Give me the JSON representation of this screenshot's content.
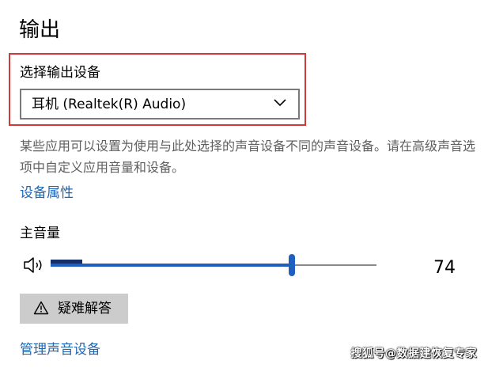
{
  "section": {
    "title": "输出"
  },
  "output_device": {
    "label": "选择输出设备",
    "selected": "耳机 (Realtek(R) Audio)"
  },
  "description": "某些应用可以设置为使用与此处选择的声音设备不同的声音设备。请在高级声音选项中自定义应用音量和设备。",
  "device_properties_link": "设备属性",
  "master_volume": {
    "label": "主音量",
    "value": 74,
    "value_text": "74",
    "level_fraction": 0.74
  },
  "troubleshoot_button": {
    "label": "疑难解答",
    "icon": "warning-icon"
  },
  "manage_devices_link": "管理声音设备",
  "watermark": "搜狐号@数据建恢复专家",
  "colors": {
    "highlight_border": "#d23a3a",
    "link": "#1f66b3",
    "slider_accent": "#1f5fbf",
    "button_bg": "#cccccc"
  }
}
